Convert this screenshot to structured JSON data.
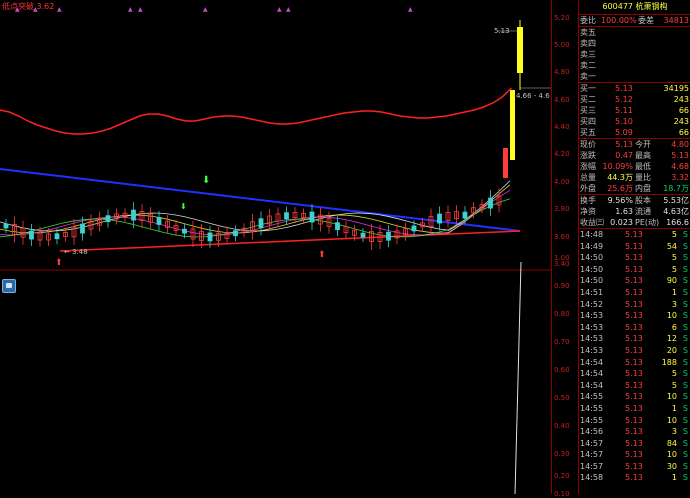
{
  "indicator": {
    "label": "低点突破",
    "value": "3.62"
  },
  "price_axis": [
    "5.20",
    "5.00",
    "4.80",
    "4.60",
    "4.40",
    "4.20",
    "4.00",
    "3.80",
    "3.60",
    "3.40"
  ],
  "volume_axis": [
    "1.00",
    "0.90",
    "0.80",
    "0.70",
    "0.60",
    "0.50",
    "0.40",
    "0.30",
    "0.20",
    "0.10"
  ],
  "chart_annotations": {
    "high_price": "5.13",
    "cursor_price": "4.66 - 4.6",
    "low_price": "3.48"
  },
  "header": {
    "code": "600477",
    "name": "杭萧钢构"
  },
  "order_book": {
    "wei_bi_label": "委比",
    "wei_bi": "100.00%",
    "wei_cha_label": "委差",
    "wei_cha": "34813",
    "asks": [
      {
        "label": "卖五"
      },
      {
        "label": "卖四"
      },
      {
        "label": "卖三"
      },
      {
        "label": "卖二"
      },
      {
        "label": "卖一"
      }
    ],
    "bids": [
      {
        "label": "买一",
        "price": "5.13",
        "vol": "34195"
      },
      {
        "label": "买二",
        "price": "5.12",
        "vol": "243"
      },
      {
        "label": "买三",
        "price": "5.11",
        "vol": "66"
      },
      {
        "label": "买四",
        "price": "5.10",
        "vol": "243"
      },
      {
        "label": "买五",
        "price": "5.09",
        "vol": "66"
      }
    ]
  },
  "quote": {
    "xianjia_label": "现价",
    "xianjia": "5.13",
    "jinkai_label": "今开",
    "jinkai": "4.80",
    "zhangdie_label": "涨跌",
    "zhangdie": "0.47",
    "zuigao_label": "最高",
    "zuigao": "5.13",
    "zhangfu_label": "涨幅",
    "zhangfu": "10.09%",
    "zuidi_label": "最低",
    "zuidi": "4.68",
    "zongliang_label": "总量",
    "zongliang": "44.3万",
    "liangbi_label": "量比",
    "liangbi": "3.32",
    "waipan_label": "外盘",
    "waipan": "25.6万",
    "neipan_label": "内盘",
    "neipan": "18.7万",
    "huanshou_label": "换手",
    "huanshou": "9.56%",
    "guben_label": "股本",
    "guben": "5.53亿",
    "jingzi_label": "净资",
    "jingzi": "1.63",
    "liutong_label": "流通",
    "liutong": "4.63亿",
    "shouyi_label": "收益㈢",
    "shouyi": "0.023",
    "pe_label": "PE(动)",
    "pe": "166.6"
  },
  "ticks": [
    {
      "time": "14:48",
      "price": "5.13",
      "vol": "5",
      "dir": "S"
    },
    {
      "time": "14:49",
      "price": "5.13",
      "vol": "54",
      "dir": "S"
    },
    {
      "time": "14:50",
      "price": "5.13",
      "vol": "5",
      "dir": "S"
    },
    {
      "time": "14:50",
      "price": "5.13",
      "vol": "5",
      "dir": "S"
    },
    {
      "time": "14:50",
      "price": "5.13",
      "vol": "90",
      "dir": "S"
    },
    {
      "time": "14:51",
      "price": "5.13",
      "vol": "1",
      "dir": "S"
    },
    {
      "time": "14:52",
      "price": "5.13",
      "vol": "3",
      "dir": "S"
    },
    {
      "time": "14:53",
      "price": "5.13",
      "vol": "10",
      "dir": "S"
    },
    {
      "time": "14:53",
      "price": "5.13",
      "vol": "6",
      "dir": "S"
    },
    {
      "time": "14:53",
      "price": "5.13",
      "vol": "12",
      "dir": "S"
    },
    {
      "time": "14:53",
      "price": "5.13",
      "vol": "20",
      "dir": "S"
    },
    {
      "time": "14:54",
      "price": "5.13",
      "vol": "188",
      "dir": "S"
    },
    {
      "time": "14:54",
      "price": "5.13",
      "vol": "5",
      "dir": "S"
    },
    {
      "time": "14:54",
      "price": "5.13",
      "vol": "5",
      "dir": "S"
    },
    {
      "time": "14:55",
      "price": "5.13",
      "vol": "10",
      "dir": "S"
    },
    {
      "time": "14:55",
      "price": "5.13",
      "vol": "1",
      "dir": "S"
    },
    {
      "time": "14:55",
      "price": "5.13",
      "vol": "10",
      "dir": "S"
    },
    {
      "time": "14:56",
      "price": "5.13",
      "vol": "3",
      "dir": "S"
    },
    {
      "time": "14:57",
      "price": "5.13",
      "vol": "84",
      "dir": "S"
    },
    {
      "time": "14:57",
      "price": "5.13",
      "vol": "10",
      "dir": "S"
    },
    {
      "time": "14:57",
      "price": "5.13",
      "vol": "30",
      "dir": "S"
    },
    {
      "time": "14:58",
      "price": "5.13",
      "vol": "1",
      "dir": "S"
    }
  ],
  "colors": {
    "up": "#ff3c3c",
    "down": "#00d060",
    "highlight": "#ffff40"
  }
}
